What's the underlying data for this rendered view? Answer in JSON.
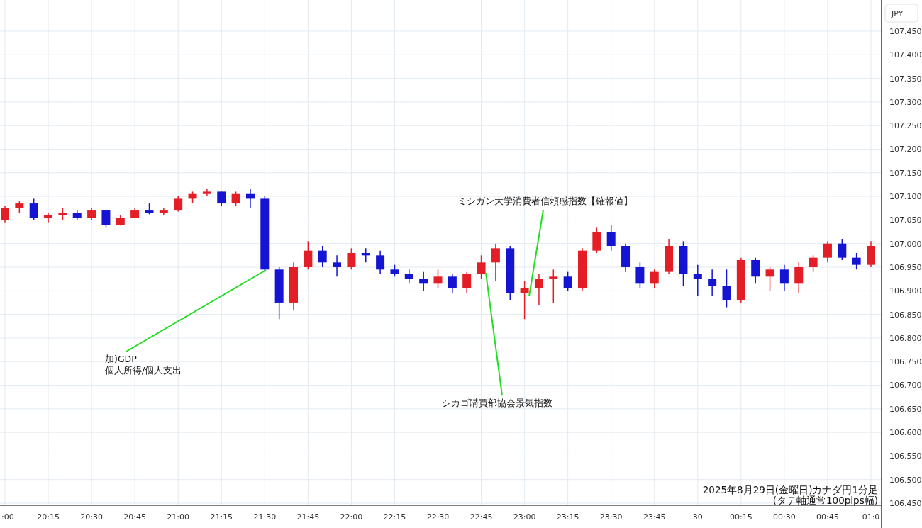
{
  "chart": {
    "currency_badge": "JPY",
    "caption": [
      "2025年8月29日(金曜日)カナダ円1分足",
      "(タテ軸通常100pips幅)"
    ],
    "chart_data": {
      "type": "candlestick",
      "categories": [
        ":00",
        null,
        null,
        "20:15",
        null,
        null,
        "20:30",
        null,
        null,
        "20:45",
        null,
        null,
        "21:00",
        null,
        null,
        "21:15",
        null,
        null,
        "21:30",
        null,
        null,
        "21:45",
        null,
        null,
        "22:00",
        null,
        null,
        "22:15",
        null,
        null,
        "22:30",
        null,
        null,
        "22:45",
        null,
        null,
        "23:00",
        null,
        null,
        "23:15",
        null,
        null,
        "23:30",
        null,
        null,
        "23:45",
        null,
        null,
        "30",
        null,
        null,
        "00:15",
        null,
        null,
        "00:30",
        null,
        null,
        "00:45",
        null,
        null,
        "01:0"
      ],
      "ohlc": [
        [
          107.05,
          107.08,
          107.045,
          107.075
        ],
        [
          107.075,
          107.09,
          107.065,
          107.085
        ],
        [
          107.085,
          107.095,
          107.05,
          107.055
        ],
        [
          107.055,
          107.065,
          107.045,
          107.06
        ],
        [
          107.06,
          107.075,
          107.05,
          107.065
        ],
        [
          107.065,
          107.07,
          107.05,
          107.055
        ],
        [
          107.055,
          107.075,
          107.05,
          107.07
        ],
        [
          107.07,
          107.072,
          107.035,
          107.04
        ],
        [
          107.04,
          107.06,
          107.038,
          107.055
        ],
        [
          107.055,
          107.075,
          107.055,
          107.07
        ],
        [
          107.07,
          107.085,
          107.062,
          107.065
        ],
        [
          107.065,
          107.075,
          107.06,
          107.07
        ],
        [
          107.07,
          107.1,
          107.068,
          107.095
        ],
        [
          107.095,
          107.11,
          107.085,
          107.105
        ],
        [
          107.105,
          107.115,
          107.1,
          107.11
        ],
        [
          107.11,
          107.11,
          107.08,
          107.085
        ],
        [
          107.085,
          107.11,
          107.08,
          107.105
        ],
        [
          107.105,
          107.115,
          107.075,
          107.095
        ],
        [
          107.095,
          107.1,
          106.94,
          106.945
        ],
        [
          106.945,
          106.95,
          106.84,
          106.875
        ],
        [
          106.875,
          106.96,
          106.86,
          106.95
        ],
        [
          106.95,
          107.005,
          106.945,
          106.985
        ],
        [
          106.985,
          106.995,
          106.95,
          106.96
        ],
        [
          106.96,
          106.975,
          106.93,
          106.95
        ],
        [
          106.95,
          106.99,
          106.945,
          106.98
        ],
        [
          106.98,
          106.99,
          106.96,
          106.975
        ],
        [
          106.975,
          106.985,
          106.935,
          106.945
        ],
        [
          106.945,
          106.955,
          106.93,
          106.935
        ],
        [
          106.935,
          106.945,
          106.915,
          106.925
        ],
        [
          106.925,
          106.94,
          106.9,
          106.915
        ],
        [
          106.915,
          106.945,
          106.905,
          106.93
        ],
        [
          106.93,
          106.935,
          106.895,
          106.905
        ],
        [
          106.905,
          106.94,
          106.895,
          106.935
        ],
        [
          106.935,
          106.975,
          106.925,
          106.96
        ],
        [
          106.96,
          107.0,
          106.92,
          106.99
        ],
        [
          106.99,
          106.995,
          106.88,
          106.895
        ],
        [
          106.895,
          106.92,
          106.84,
          106.905
        ],
        [
          106.905,
          106.935,
          106.87,
          106.925
        ],
        [
          106.925,
          106.945,
          106.875,
          106.93
        ],
        [
          106.93,
          106.94,
          106.9,
          106.905
        ],
        [
          106.905,
          106.99,
          106.9,
          106.985
        ],
        [
          106.985,
          107.035,
          106.98,
          107.025
        ],
        [
          107.025,
          107.04,
          106.985,
          106.995
        ],
        [
          106.995,
          107.0,
          106.94,
          106.95
        ],
        [
          106.95,
          106.96,
          106.905,
          106.915
        ],
        [
          106.915,
          106.945,
          106.905,
          106.94
        ],
        [
          106.94,
          107.01,
          106.935,
          106.995
        ],
        [
          106.995,
          107.005,
          106.91,
          106.935
        ],
        [
          106.935,
          106.955,
          106.89,
          106.925
        ],
        [
          106.925,
          106.945,
          106.89,
          106.91
        ],
        [
          106.91,
          106.945,
          106.865,
          106.88
        ],
        [
          106.88,
          106.97,
          106.875,
          106.965
        ],
        [
          106.965,
          106.97,
          106.915,
          106.93
        ],
        [
          106.93,
          106.95,
          106.9,
          106.945
        ],
        [
          106.945,
          106.955,
          106.9,
          106.915
        ],
        [
          106.915,
          106.96,
          106.895,
          106.95
        ],
        [
          106.95,
          106.975,
          106.94,
          106.97
        ],
        [
          106.97,
          107.005,
          106.96,
          107.0
        ],
        [
          107.0,
          107.01,
          106.965,
          106.97
        ],
        [
          106.97,
          106.98,
          106.945,
          106.955
        ],
        [
          106.955,
          107.005,
          106.95,
          106.995
        ]
      ],
      "ylim": [
        106.4455,
        107.516
      ],
      "grid": true,
      "yticks": [
        {
          "value": 106.45,
          "label": "106.450"
        },
        {
          "value": 106.5,
          "label": "106.500"
        },
        {
          "value": 106.55,
          "label": "106.550"
        },
        {
          "value": 106.6,
          "label": "106.600"
        },
        {
          "value": 106.65,
          "label": "106.650"
        },
        {
          "value": 106.7,
          "label": "106.700"
        },
        {
          "value": 106.75,
          "label": "106.750"
        },
        {
          "value": 106.8,
          "label": "106.800"
        },
        {
          "value": 106.85,
          "label": "106.850"
        },
        {
          "value": 106.9,
          "label": "106.900"
        },
        {
          "value": 106.95,
          "label": "106.950"
        },
        {
          "value": 107.0,
          "label": "107.000"
        },
        {
          "value": 107.05,
          "label": "107.050"
        },
        {
          "value": 107.1,
          "label": "107.100"
        },
        {
          "value": 107.15,
          "label": "107.150"
        },
        {
          "value": 107.2,
          "label": "107.200"
        },
        {
          "value": 107.25,
          "label": "107.250"
        },
        {
          "value": 107.3,
          "label": "107.300"
        },
        {
          "value": 107.35,
          "label": "107.350"
        },
        {
          "value": 107.4,
          "label": "107.400"
        },
        {
          "value": 107.45,
          "label": "107.450"
        }
      ]
    },
    "callouts": [
      {
        "lines": [
          "ミシガン大学消費者信頼感指数【確報値】"
        ]
      },
      {
        "lines": [
          "加)GDP",
          "個人所得/個人支出"
        ]
      },
      {
        "lines": [
          "シカゴ購買部協会景気指数"
        ]
      }
    ]
  }
}
